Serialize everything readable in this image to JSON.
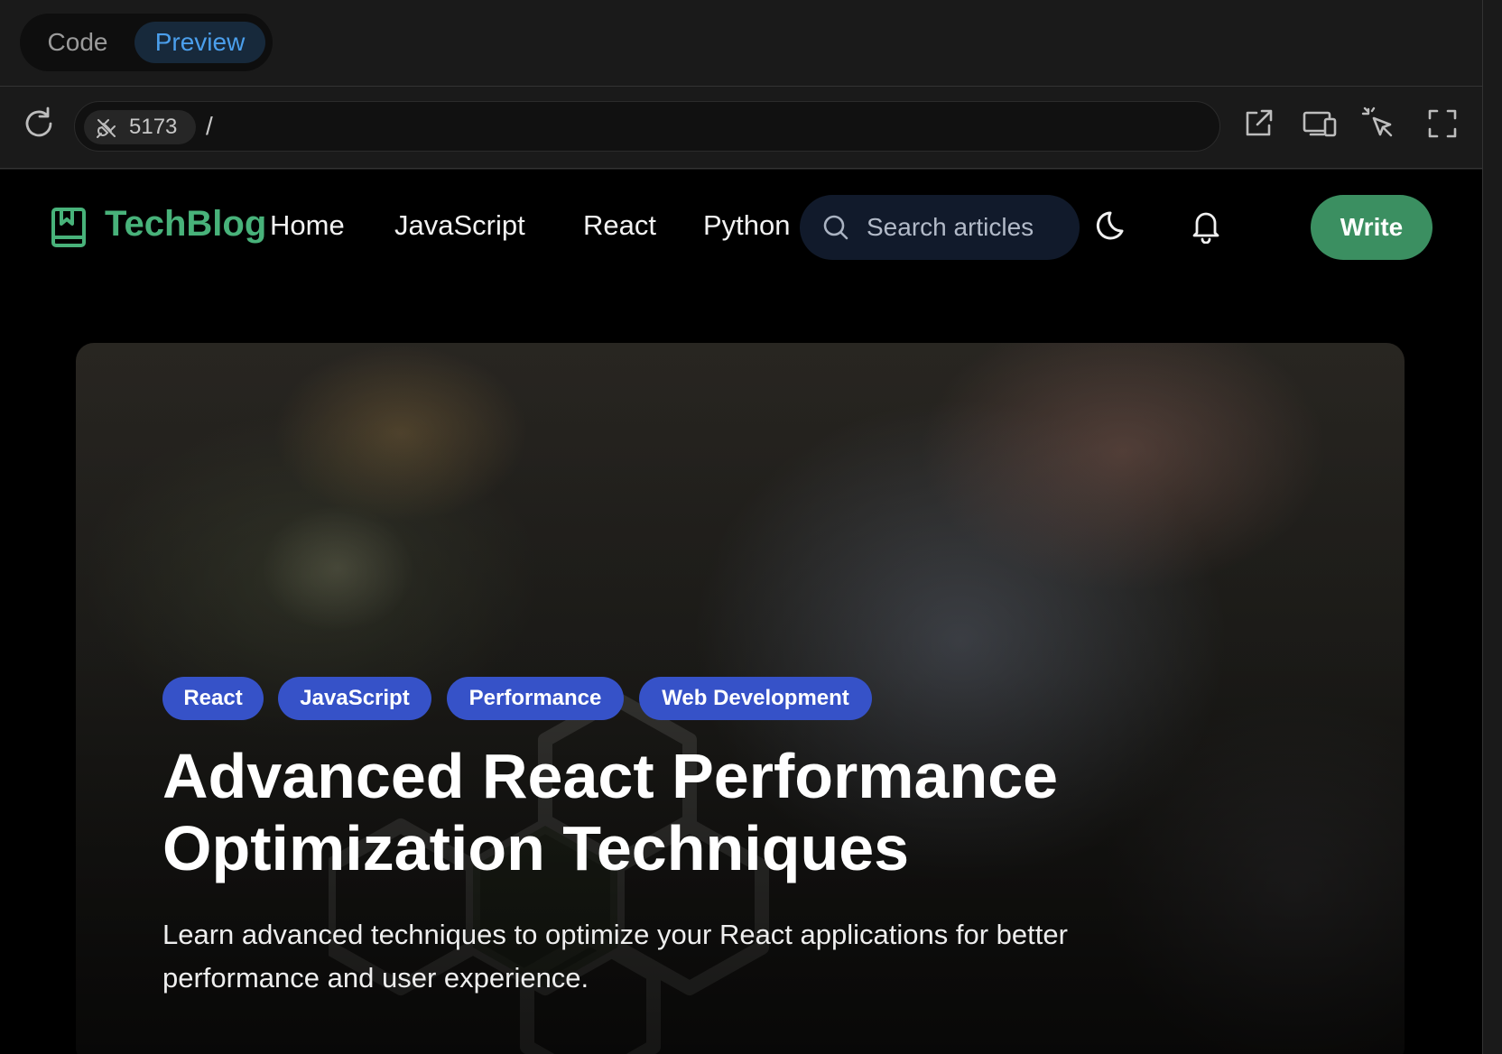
{
  "editor": {
    "tabs": {
      "code": "Code",
      "preview": "Preview"
    },
    "url": {
      "port": "5173",
      "path": "/"
    }
  },
  "site": {
    "brand": "TechBlog",
    "nav": [
      "Home",
      "JavaScript",
      "React",
      "Python"
    ],
    "search_placeholder": "Search articles",
    "write_label": "Write",
    "accent": "#48b27a"
  },
  "hero": {
    "tags": [
      "React",
      "JavaScript",
      "Performance",
      "Web Development"
    ],
    "title_line1": "Advanced React Performance",
    "title_line2": "Optimization Techniques",
    "description": "Learn advanced techniques to optimize your React applications for better performance and user experience."
  }
}
